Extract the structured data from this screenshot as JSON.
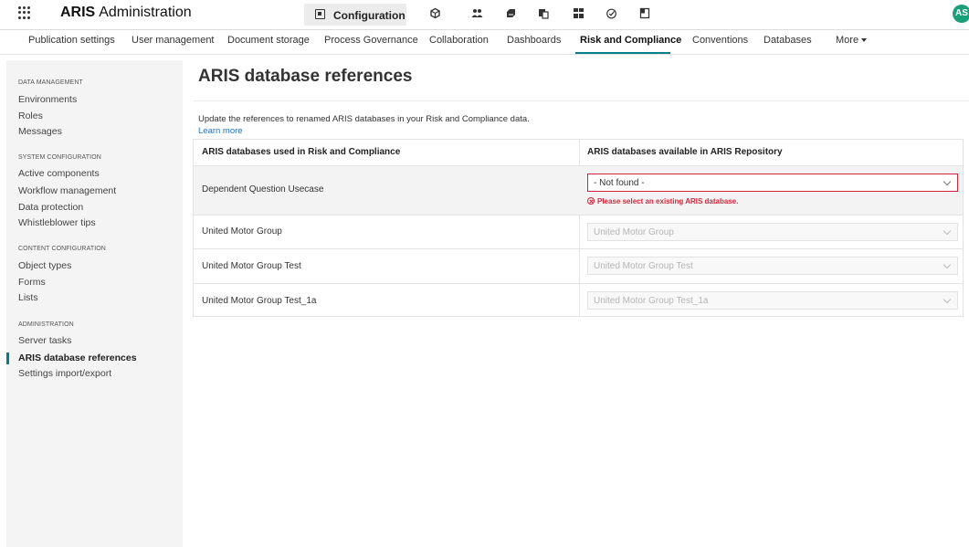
{
  "header": {
    "app_title_bold": "ARIS",
    "app_title_rest": "Administration",
    "active_module": "Configuration",
    "avatar_initials": "AS"
  },
  "subnav": {
    "items": [
      "Publication settings",
      "User management",
      "Document storage",
      "Process Governance",
      "Collaboration",
      "Dashboards",
      "Risk and Compliance",
      "Conventions",
      "Databases",
      "More"
    ],
    "active": "Risk and Compliance"
  },
  "sidebar": {
    "sections": [
      {
        "heading": "DATA MANAGEMENT",
        "items": [
          "Environments",
          "Roles",
          "Messages"
        ]
      },
      {
        "heading": "SYSTEM CONFIGURATION",
        "items": [
          "Active components",
          "Workflow management",
          "Data protection",
          "Whistleblower tips"
        ]
      },
      {
        "heading": "CONTENT CONFIGURATION",
        "items": [
          "Object types",
          "Forms",
          "Lists"
        ]
      },
      {
        "heading": "ADMINISTRATION",
        "items": [
          "Server tasks",
          "ARIS database references",
          "Settings import/export"
        ]
      }
    ],
    "active": "ARIS database references"
  },
  "main": {
    "title": "ARIS database references",
    "description": "Update the references to renamed ARIS databases in your Risk and Compliance data.",
    "learn_more": "Learn more",
    "table": {
      "col1_header": "ARIS databases used in Risk and Compliance",
      "col2_header": "ARIS databases available in ARIS Repository",
      "rows": [
        {
          "used": "Dependent Question Usecase",
          "selected": "- Not found -",
          "error": "Please select an existing ARIS database."
        },
        {
          "used": "United Motor Group",
          "selected": "United Motor Group"
        },
        {
          "used": "United Motor Group Test",
          "selected": "United Motor Group Test"
        },
        {
          "used": "United Motor Group Test_1a",
          "selected": "United Motor Group Test_1a"
        }
      ]
    }
  },
  "colors": {
    "accent": "#00808a",
    "error": "#d0283a",
    "link": "#1a73c9",
    "avatar": "#18a07a"
  }
}
